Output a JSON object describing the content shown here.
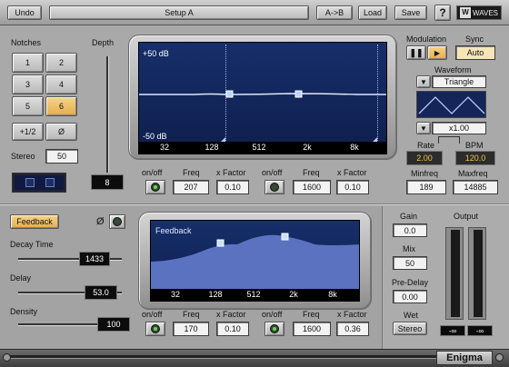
{
  "toolbar": {
    "undo_label": "Undo",
    "setup_name": "Setup A",
    "ab_label": "A->B",
    "load_label": "Load",
    "save_label": "Save",
    "help_label": "?",
    "brand": "WAVES"
  },
  "notches": {
    "title": "Notches",
    "buttons": [
      "1",
      "2",
      "3",
      "4",
      "5",
      "6"
    ],
    "selected": "6",
    "half_label": "+1/2",
    "phase_label": "Ø",
    "stereo_label": "Stereo",
    "stereo_value": "50"
  },
  "depth": {
    "title": "Depth",
    "value": "8"
  },
  "notch_display": {
    "top_db": "+50 dB",
    "bottom_db": "-50 dB",
    "axis_ticks": [
      "32",
      "128",
      "512",
      "2k",
      "8k"
    ]
  },
  "notch_controls": {
    "onoff_label": "on/off",
    "freq_label": "Freq",
    "xfactor_label": "x Factor",
    "band1_freq": "207",
    "band1_xfactor": "0.10",
    "band2_freq": "1600",
    "band2_xfactor": "0.10"
  },
  "modulation": {
    "title": "Modulation",
    "pause_icon": "pause-icon",
    "play_icon": "play-icon",
    "sync_title": "Sync",
    "sync_value": "Auto",
    "waveform_title": "Waveform",
    "waveform_value": "Triangle",
    "multiplier_value": "x1.00",
    "rate_label": "Rate",
    "bpm_label": "BPM",
    "rate_value": "2.00",
    "bpm_value": "120.0",
    "minfreq_label": "Minfreq",
    "maxfreq_label": "Maxfreq",
    "minfreq_value": "189",
    "maxfreq_value": "14885"
  },
  "feedback": {
    "toggle_label": "Feedback",
    "phase_label": "Ø",
    "decay_label": "Decay Time",
    "decay_value": "1433",
    "delay_label": "Delay",
    "delay_value": "53.0",
    "density_label": "Density",
    "density_value": "100",
    "display_title": "Feedback",
    "axis_ticks": [
      "32",
      "128",
      "512",
      "2k",
      "8k"
    ],
    "band1_freq": "170",
    "band1_xfactor": "0.10",
    "band2_freq": "1600",
    "band2_xfactor": "0.36"
  },
  "output": {
    "gain_label": "Gain",
    "gain_value": "0.0",
    "mix_label": "Mix",
    "mix_value": "50",
    "predelay_label": "Pre-Delay",
    "predelay_value": "0.00",
    "wet_label": "Wet",
    "wet_value": "Stereo",
    "output_label": "Output",
    "meter_left": "-∞",
    "meter_right": "-∞"
  },
  "footer": {
    "plugin_name": "Enigma"
  },
  "colors": {
    "panel": "#a9a9a9",
    "screen": "#162e6a",
    "accent_amber": "#e6ac4d",
    "led_green": "#74d45e"
  }
}
